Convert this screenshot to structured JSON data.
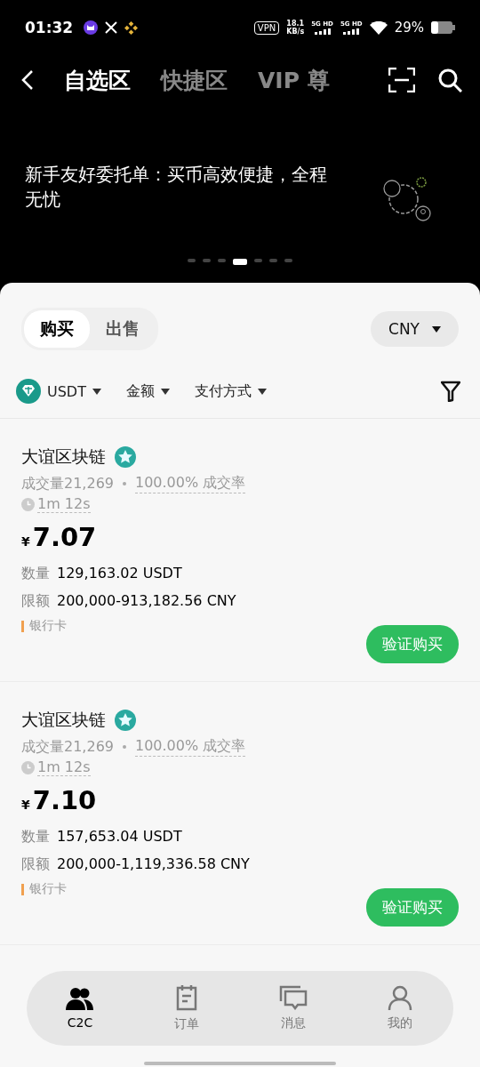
{
  "status_bar": {
    "time": "01:32",
    "vpn": "VPN",
    "speed": "18.1",
    "speed_unit": "KB/s",
    "networks": [
      "5G HD",
      "5G HD"
    ],
    "battery": "29%"
  },
  "tabs": [
    {
      "label": "自选区",
      "selected": true
    },
    {
      "label": "快捷区",
      "selected": false
    },
    {
      "label": "VIP 尊",
      "selected": false
    }
  ],
  "banner": {
    "text": "新手友好委托单：买币高效便捷，全程无忧",
    "dots": [
      {
        "selected": false
      },
      {
        "selected": false
      },
      {
        "selected": false
      },
      {
        "selected": true
      },
      {
        "selected": false
      },
      {
        "selected": false
      },
      {
        "selected": false
      }
    ]
  },
  "side_toggle": [
    {
      "label": "购买",
      "selected": true
    },
    {
      "label": "出售",
      "selected": false
    }
  ],
  "currency": "CNY",
  "filters": [
    {
      "label": "USDT",
      "kind": "coin"
    },
    {
      "label": "金额",
      "kind": "plain"
    },
    {
      "label": "支付方式",
      "kind": "plain"
    }
  ],
  "offers": [
    {
      "merchant": "大谊区块链",
      "volume": "成交量21,269",
      "rate": "100.00% 成交率",
      "time": "1m 12s",
      "currency_symbol": "¥",
      "price": "7.07",
      "qty_label": "数量",
      "qty": "129,163.02 USDT",
      "limit_label": "限额",
      "limit": "200,000-913,182.56 CNY",
      "payment": "银行卡",
      "action": "验证购买"
    },
    {
      "merchant": "大谊区块链",
      "volume": "成交量21,269",
      "rate": "100.00% 成交率",
      "time": "1m 12s",
      "currency_symbol": "¥",
      "price": "7.10",
      "qty_label": "数量",
      "qty": "157,653.04 USDT",
      "limit_label": "限额",
      "limit": "200,000-1,119,336.58 CNY",
      "payment": "银行卡",
      "action": "验证购买"
    }
  ],
  "bottom_nav": [
    {
      "label": "C2C",
      "selected": true,
      "kind": "people"
    },
    {
      "label": "订单",
      "selected": false,
      "kind": "clipboard"
    },
    {
      "label": "消息",
      "selected": false,
      "kind": "chat"
    },
    {
      "label": "我的",
      "selected": false,
      "kind": "person"
    }
  ]
}
